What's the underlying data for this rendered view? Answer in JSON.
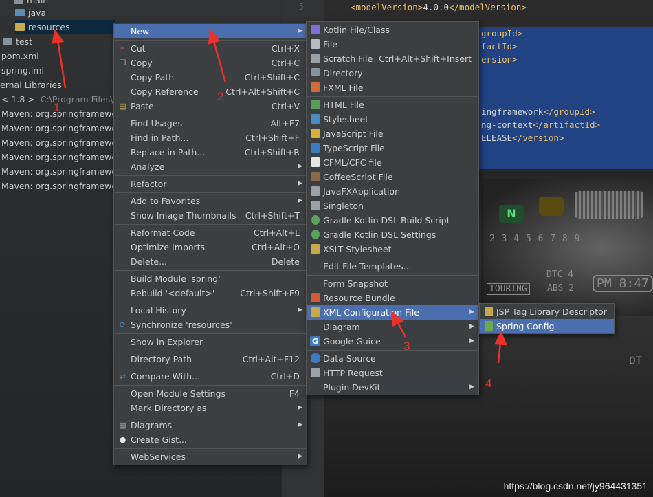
{
  "tree": {
    "rows": [
      {
        "label": "main",
        "note": ""
      },
      {
        "label": "java",
        "note": ""
      },
      {
        "label": "resources",
        "note": ""
      },
      {
        "label": "test",
        "note": ""
      },
      {
        "label": "pom.xml",
        "note": ""
      },
      {
        "label": "spring.iml",
        "note": ""
      },
      {
        "label": "ernal Libraries",
        "note": ""
      },
      {
        "label": "< 1.8 >",
        "note": "C:\\Program Files\\Ja"
      },
      {
        "label": "Maven: org.springframework",
        "note": ""
      },
      {
        "label": "Maven: org.springframework",
        "note": ""
      },
      {
        "label": "Maven: org.springframework",
        "note": ""
      },
      {
        "label": "Maven: org.springframework",
        "note": ""
      },
      {
        "label": "Maven: org.springframework",
        "note": ""
      },
      {
        "label": "Maven: org.springframework",
        "note": ""
      }
    ]
  },
  "editor": {
    "line_number": "5",
    "lines": [
      {
        "open": "<modelVersion>",
        "text": "4.0.0",
        "close": "</modelVersion>"
      },
      {
        "open": "",
        "text": "",
        "close": "groupId>"
      },
      {
        "open": "",
        "text": "",
        "close": "factId>"
      },
      {
        "open": "",
        "text": "",
        "close": "ersion>"
      },
      {
        "open": "",
        "text": "ingframework",
        "close": "</groupId>"
      },
      {
        "open": "",
        "text": "ng-context",
        "close": "</artifactId>"
      },
      {
        "open": "",
        "text": "ELEASE",
        "close": "</version>"
      }
    ],
    "dash": {
      "gear": "N",
      "scale": "2  3  4  5  6  7  8  9",
      "mode": "DTC 4",
      "touring": "TOURING",
      "abs": "ABS 2",
      "pm": "PM",
      "clock": "8:47",
      "odo": "OT"
    }
  },
  "context_menu": {
    "items": [
      {
        "label": "New",
        "shortcut": "",
        "submenu": true,
        "icon": ""
      },
      {
        "label": "Cut",
        "shortcut": "Ctrl+X",
        "submenu": false,
        "icon": "✂"
      },
      {
        "label": "Copy",
        "shortcut": "Ctrl+C",
        "submenu": false,
        "icon": "❐"
      },
      {
        "label": "Copy Path",
        "shortcut": "Ctrl+Shift+C",
        "submenu": false,
        "icon": ""
      },
      {
        "label": "Copy Reference",
        "shortcut": "Ctrl+Alt+Shift+C",
        "submenu": false,
        "icon": ""
      },
      {
        "label": "Paste",
        "shortcut": "Ctrl+V",
        "submenu": false,
        "icon": "📋"
      },
      {
        "label": "Find Usages",
        "shortcut": "Alt+F7",
        "submenu": false,
        "icon": ""
      },
      {
        "label": "Find in Path...",
        "shortcut": "Ctrl+Shift+F",
        "submenu": false,
        "icon": ""
      },
      {
        "label": "Replace in Path...",
        "shortcut": "Ctrl+Shift+R",
        "submenu": false,
        "icon": ""
      },
      {
        "label": "Analyze",
        "shortcut": "",
        "submenu": true,
        "icon": ""
      },
      {
        "label": "Refactor",
        "shortcut": "",
        "submenu": true,
        "icon": ""
      },
      {
        "label": "Add to Favorites",
        "shortcut": "",
        "submenu": true,
        "icon": ""
      },
      {
        "label": "Show Image Thumbnails",
        "shortcut": "Ctrl+Shift+T",
        "submenu": false,
        "icon": ""
      },
      {
        "label": "Reformat Code",
        "shortcut": "Ctrl+Alt+L",
        "submenu": false,
        "icon": ""
      },
      {
        "label": "Optimize Imports",
        "shortcut": "Ctrl+Alt+O",
        "submenu": false,
        "icon": ""
      },
      {
        "label": "Delete...",
        "shortcut": "Delete",
        "submenu": false,
        "icon": ""
      },
      {
        "label": "Build Module 'spring'",
        "shortcut": "",
        "submenu": false,
        "icon": ""
      },
      {
        "label": "Rebuild '<default>'",
        "shortcut": "Ctrl+Shift+F9",
        "submenu": false,
        "icon": ""
      },
      {
        "label": "Local History",
        "shortcut": "",
        "submenu": true,
        "icon": ""
      },
      {
        "label": "Synchronize 'resources'",
        "shortcut": "",
        "submenu": false,
        "icon": "⟳"
      },
      {
        "label": "Show in Explorer",
        "shortcut": "",
        "submenu": false,
        "icon": ""
      },
      {
        "label": "Directory Path",
        "shortcut": "Ctrl+Alt+F12",
        "submenu": false,
        "icon": ""
      },
      {
        "label": "Compare With...",
        "shortcut": "Ctrl+D",
        "submenu": false,
        "icon": "⇄"
      },
      {
        "label": "Open Module Settings",
        "shortcut": "F4",
        "submenu": false,
        "icon": ""
      },
      {
        "label": "Mark Directory as",
        "shortcut": "",
        "submenu": true,
        "icon": ""
      },
      {
        "label": "Diagrams",
        "shortcut": "",
        "submenu": true,
        "icon": "▦"
      },
      {
        "label": "Create Gist...",
        "shortcut": "",
        "submenu": false,
        "icon": "●"
      },
      {
        "label": "WebServices",
        "shortcut": "",
        "submenu": true,
        "icon": ""
      }
    ]
  },
  "new_menu": {
    "items": [
      {
        "label": "Kotlin File/Class",
        "shortcut": "",
        "submenu": false,
        "color": "#7f6fd6"
      },
      {
        "label": "File",
        "shortcut": "",
        "submenu": false,
        "color": "#b8bcc0"
      },
      {
        "label": "Scratch File",
        "shortcut": "Ctrl+Alt+Shift+Insert",
        "submenu": false,
        "color": "#9aa2a8"
      },
      {
        "label": "Directory",
        "shortcut": "",
        "submenu": false,
        "color": "#87939a"
      },
      {
        "label": "FXML File",
        "shortcut": "",
        "submenu": false,
        "color": "#d06b3a"
      },
      {
        "label": "HTML File",
        "shortcut": "",
        "submenu": false,
        "color": "#5b9c57"
      },
      {
        "label": "Stylesheet",
        "shortcut": "",
        "submenu": false,
        "color": "#4a8bc2"
      },
      {
        "label": "JavaScript File",
        "shortcut": "",
        "submenu": false,
        "color": "#d5b13c"
      },
      {
        "label": "TypeScript File",
        "shortcut": "",
        "submenu": false,
        "color": "#3d7bc0"
      },
      {
        "label": "CFML/CFC file",
        "shortcut": "",
        "submenu": false,
        "color": "#e6e6e6"
      },
      {
        "label": "CoffeeScript File",
        "shortcut": "",
        "submenu": false,
        "color": "#8a6a4a"
      },
      {
        "label": "JavaFXApplication",
        "shortcut": "",
        "submenu": false,
        "color": "#9aa2a8"
      },
      {
        "label": "Singleton",
        "shortcut": "",
        "submenu": false,
        "color": "#9aa2a8"
      },
      {
        "label": "Gradle Kotlin DSL Build Script",
        "shortcut": "",
        "submenu": false,
        "color": "#5aa35a"
      },
      {
        "label": "Gradle Kotlin DSL Settings",
        "shortcut": "",
        "submenu": false,
        "color": "#5aa35a"
      },
      {
        "label": "XSLT Stylesheet",
        "shortcut": "",
        "submenu": false,
        "color": "#c7a84a"
      },
      {
        "label": "Edit File Templates...",
        "shortcut": "",
        "submenu": false,
        "color": ""
      },
      {
        "label": "Form Snapshot",
        "shortcut": "",
        "submenu": false,
        "color": ""
      },
      {
        "label": "Resource Bundle",
        "shortcut": "",
        "submenu": false,
        "color": "#d05a3a"
      },
      {
        "label": "XML Configuration File",
        "shortcut": "",
        "submenu": true,
        "color": "#c7a84a"
      },
      {
        "label": "Diagram",
        "shortcut": "",
        "submenu": true,
        "color": ""
      },
      {
        "label": "Google Guice",
        "shortcut": "",
        "submenu": true,
        "color": "#3d7bc0"
      },
      {
        "label": "Data Source",
        "shortcut": "",
        "submenu": false,
        "color": "#3d7bc0"
      },
      {
        "label": "HTTP Request",
        "shortcut": "",
        "submenu": false,
        "color": "#9aa2a8"
      },
      {
        "label": "Plugin DevKit",
        "shortcut": "",
        "submenu": true,
        "color": ""
      }
    ]
  },
  "xml_menu": {
    "items": [
      {
        "label": "JSP Tag Library Descriptor"
      },
      {
        "label": "Spring Config"
      }
    ]
  },
  "annotations": {
    "n1": "1",
    "n2": "2",
    "n3": "3",
    "n4": "4"
  },
  "watermark": "https://blog.csdn.net/jy964431351",
  "colors": {
    "highlight": "#4b6eaf",
    "menu_bg": "#3c3f41",
    "arrow": "#e8322a"
  }
}
